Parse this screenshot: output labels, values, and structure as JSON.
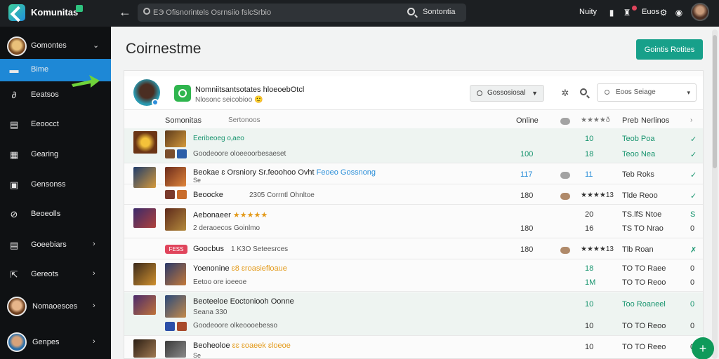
{
  "app": {
    "name": "Komunitas",
    "icon": "k-logo-icon"
  },
  "topbar": {
    "back_icon": "back-arrow-icon",
    "search_placeholder": "ЕЭ Ofisnorintels Osrnsiio fslcSrbio",
    "search_label": "Sontontia",
    "right_label": "Nuity",
    "right_label_2": "Euos",
    "icons": [
      "bookmark-icon",
      "notification-icon",
      "settings-icon",
      "help-icon"
    ]
  },
  "sidebar": {
    "items": [
      {
        "label": "Gomontes",
        "icon": "avatar",
        "chevron": "⌄"
      },
      {
        "label": "Bime",
        "icon": "folder-icon",
        "active": true
      },
      {
        "label": "Eeatsos",
        "icon": "link-icon"
      },
      {
        "label": "Eeoocct",
        "icon": "document-icon"
      },
      {
        "label": "Gearing",
        "icon": "grid-icon"
      },
      {
        "label": "Gensonss",
        "icon": "calendar-icon"
      },
      {
        "label": "Beoeolls",
        "icon": "tag-icon"
      },
      {
        "label": "Goeebiars",
        "icon": "list-icon",
        "chevron": "›"
      },
      {
        "label": "Gereots",
        "icon": "share-icon",
        "chevron": "›"
      },
      {
        "label": "Nomaoesces",
        "icon": "avatar",
        "chevron": "›"
      },
      {
        "label": "Genpes",
        "icon": "avatar",
        "chevron": "›"
      }
    ]
  },
  "main": {
    "title": "Coirnestme",
    "primary_button": "Gointis Rotites"
  },
  "filter": {
    "title": "Nomniitsantsotates hloeoebOtcl",
    "subtitle": "Nlosonc seicobioo",
    "subtitle_accent": "🙂",
    "select_a": "Gossosiosal",
    "select_b": "Eoos Seiage",
    "icons": [
      "gear-icon",
      "search-icon"
    ]
  },
  "columns": {
    "name": "Somonitas",
    "name_sub": "Sertonoos",
    "online": "Online",
    "rating": "★★★★ð",
    "prob": "Preb",
    "notes": "Nerlinos",
    "chevron": "›"
  },
  "rows": [
    {
      "title": "Eeribeoeg  o‚aeo",
      "subtitle": "Goodeoore oloeeoorbesaeset",
      "online": "100",
      "col_b": "10",
      "col_b_2": "18",
      "prob": "Teob  Poa",
      "prob_2": "Teoo  Nea",
      "check": "✓",
      "check_2": "✓"
    },
    {
      "title": "Beokae  ɛ  Orsniory  Sr.feoohoo  Ovht",
      "title_link": "Feoeo  Gossnong",
      "subtitle": "Se",
      "online": "117",
      "col_b": "11",
      "prob": "Teb  Roks",
      "check": "✓"
    },
    {
      "title": "Beoocke",
      "subtitle": "2305  Corrntl  Ohnltoe",
      "online": "180",
      "rating": "★★★★13",
      "prob": "Tlde  Reoo",
      "check": "✓"
    },
    {
      "title": "Aebonaeer",
      "title_accent": "★★★★★",
      "subtitle": "2  deraoecos  Goinlmo",
      "online": "180",
      "col_b": "20",
      "col_b_2": "16",
      "prob": "TS.lfS  Ntoe",
      "prob_2": "TS  TO  Nrao",
      "check": "S",
      "check_2": "0"
    },
    {
      "title": "Goocbus",
      "subtitle": "1  K3O  Seteesrces",
      "badge": "FESS",
      "online": "180",
      "rating": "★★★★13",
      "prob": "Tlb  Roan",
      "check": "✗"
    },
    {
      "title": "Yoenonine",
      "title_accent": "ɛ8  ɛroasiefloaue",
      "subtitle": "Eetoo ore  ioeeoe",
      "col_b": "18",
      "col_b_2": "1M",
      "prob": "TO  TO  Raee",
      "prob_2": "TO  TO  Reoo",
      "check": "0",
      "check_2": "0"
    },
    {
      "title": "Beoteeloe  Eoctoniooh  Oonne",
      "subtitle": "Seana  330",
      "subtitle_2": "Goodeoore  olkeoooebesso",
      "col_b": "10",
      "col_b_2": "10",
      "prob": "Too  Roaneel",
      "prob_2": "TO  TO  Reoo",
      "check": "0",
      "check_2": "0"
    },
    {
      "title": "Beoheoloe",
      "title_accent": "ɛɛ  ɛoaeek  ɛloeoe",
      "subtitle": "Se",
      "col_b": "10",
      "prob": "TO  TO  Reeo",
      "check": "0"
    }
  ],
  "fab": {
    "icon": "plus-icon",
    "label": "+"
  },
  "colors": {
    "accent": "#17a08a",
    "active_nav": "#1e88d6",
    "sidebar": "#0f1113",
    "topbar": "#1c1f22",
    "danger": "#e0455c",
    "pointer": "#6fd33a"
  }
}
